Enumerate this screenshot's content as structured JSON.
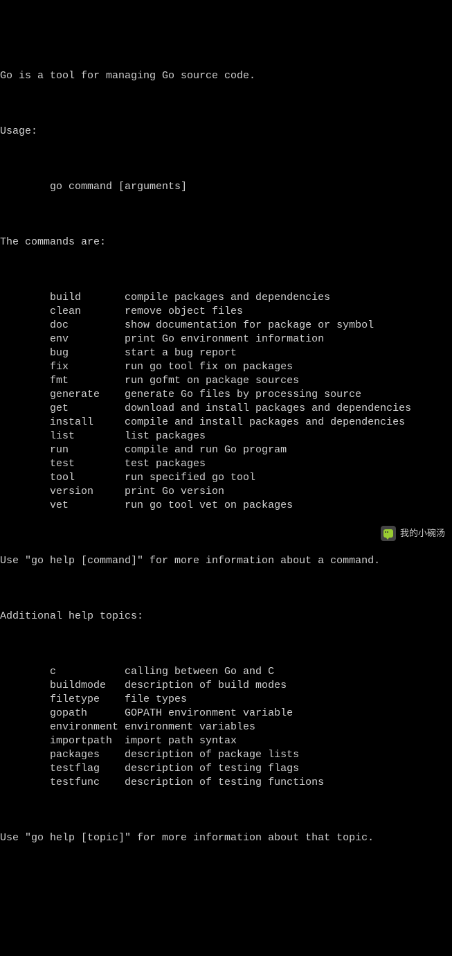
{
  "intro": "Go is a tool for managing Go source code.",
  "usage_label": "Usage:",
  "usage_line": "        go command [arguments]",
  "commands_header": "The commands are:",
  "commands": [
    {
      "name": "build",
      "desc": "compile packages and dependencies"
    },
    {
      "name": "clean",
      "desc": "remove object files"
    },
    {
      "name": "doc",
      "desc": "show documentation for package or symbol"
    },
    {
      "name": "env",
      "desc": "print Go environment information"
    },
    {
      "name": "bug",
      "desc": "start a bug report"
    },
    {
      "name": "fix",
      "desc": "run go tool fix on packages"
    },
    {
      "name": "fmt",
      "desc": "run gofmt on package sources"
    },
    {
      "name": "generate",
      "desc": "generate Go files by processing source"
    },
    {
      "name": "get",
      "desc": "download and install packages and dependencies"
    },
    {
      "name": "install",
      "desc": "compile and install packages and dependencies"
    },
    {
      "name": "list",
      "desc": "list packages"
    },
    {
      "name": "run",
      "desc": "compile and run Go program"
    },
    {
      "name": "test",
      "desc": "test packages"
    },
    {
      "name": "tool",
      "desc": "run specified go tool"
    },
    {
      "name": "version",
      "desc": "print Go version"
    },
    {
      "name": "vet",
      "desc": "run go tool vet on packages"
    }
  ],
  "help_cmd": "Use \"go help [command]\" for more information about a command.",
  "topics_header": "Additional help topics:",
  "topics": [
    {
      "name": "c",
      "desc": "calling between Go and C"
    },
    {
      "name": "buildmode",
      "desc": "description of build modes"
    },
    {
      "name": "filetype",
      "desc": "file types"
    },
    {
      "name": "gopath",
      "desc": "GOPATH environment variable"
    },
    {
      "name": "environment",
      "desc": "environment variables"
    },
    {
      "name": "importpath",
      "desc": "import path syntax"
    },
    {
      "name": "packages",
      "desc": "description of package lists"
    },
    {
      "name": "testflag",
      "desc": "description of testing flags"
    },
    {
      "name": "testfunc",
      "desc": "description of testing functions"
    }
  ],
  "help_topic": "Use \"go help [topic]\" for more information about that topic.",
  "watermark": "我的小碗汤"
}
